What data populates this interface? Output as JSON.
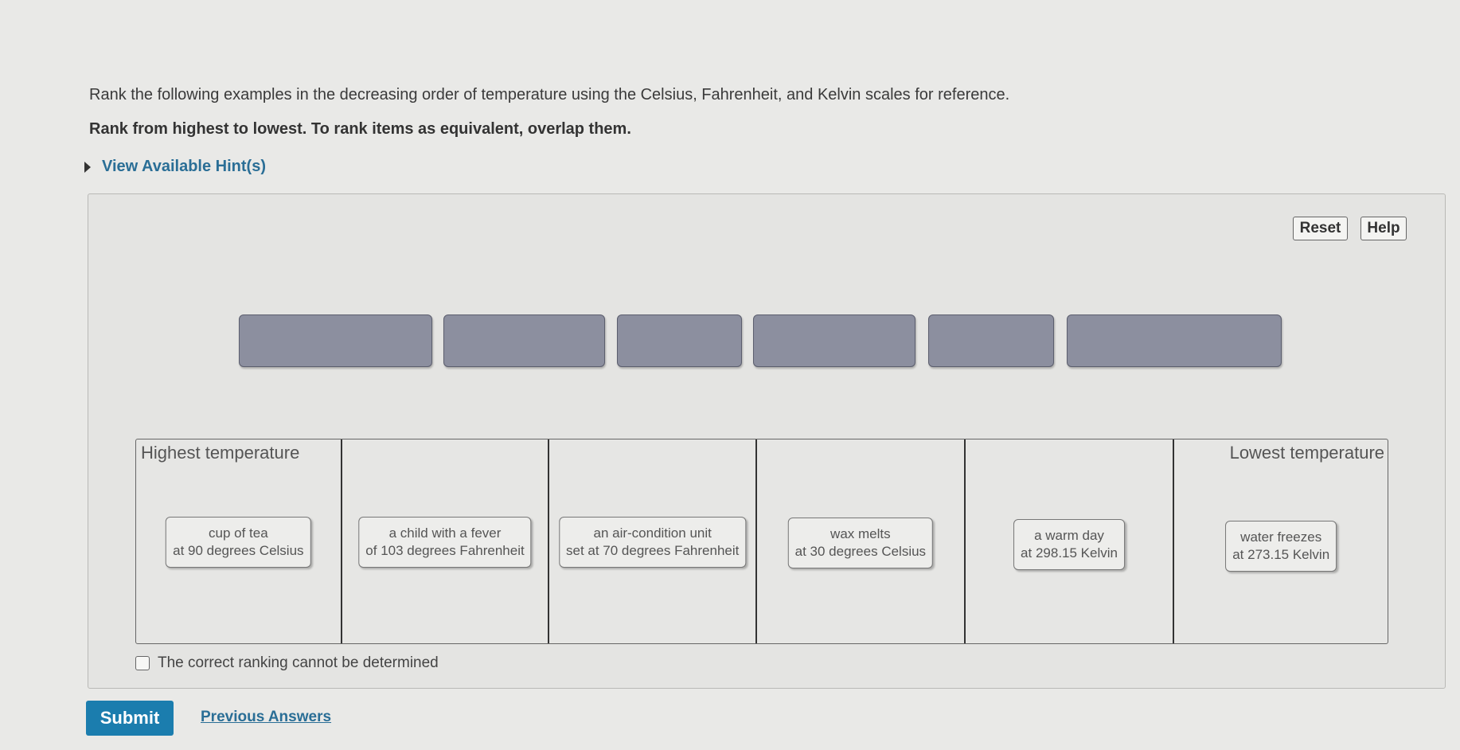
{
  "question": {
    "instruction": "Rank the following examples in the decreasing order of temperature using the Celsius, Fahrenheit, and Kelvin scales for reference.",
    "rank_note": "Rank from highest to lowest. To rank items as equivalent, overlap them.",
    "hint_link": "View Available Hint(s)"
  },
  "toolbar": {
    "reset_label": "Reset",
    "help_label": "Help"
  },
  "ranking": {
    "highest_label": "Highest temperature",
    "lowest_label": "Lowest temperature",
    "items": [
      {
        "line1": "cup of tea",
        "line2": "at 90 degrees Celsius"
      },
      {
        "line1": "a child with a fever",
        "line2": "of 103 degrees Fahrenheit"
      },
      {
        "line1": "an air-condition unit",
        "line2": "set at 70 degrees Fahrenheit"
      },
      {
        "line1": "wax melts",
        "line2": "at 30 degrees Celsius"
      },
      {
        "line1": "a warm day",
        "line2": "at 298.15 Kelvin"
      },
      {
        "line1": "water freezes",
        "line2": "at 273.15 Kelvin"
      }
    ],
    "cannot_determine_label": "The correct ranking cannot be determined",
    "cannot_determine_checked": false
  },
  "actions": {
    "submit_label": "Submit",
    "previous_answers_label": "Previous Answers"
  },
  "colors": {
    "accent": "#1b7dae",
    "link": "#2a6e96",
    "slot": "#8c8f9f"
  }
}
